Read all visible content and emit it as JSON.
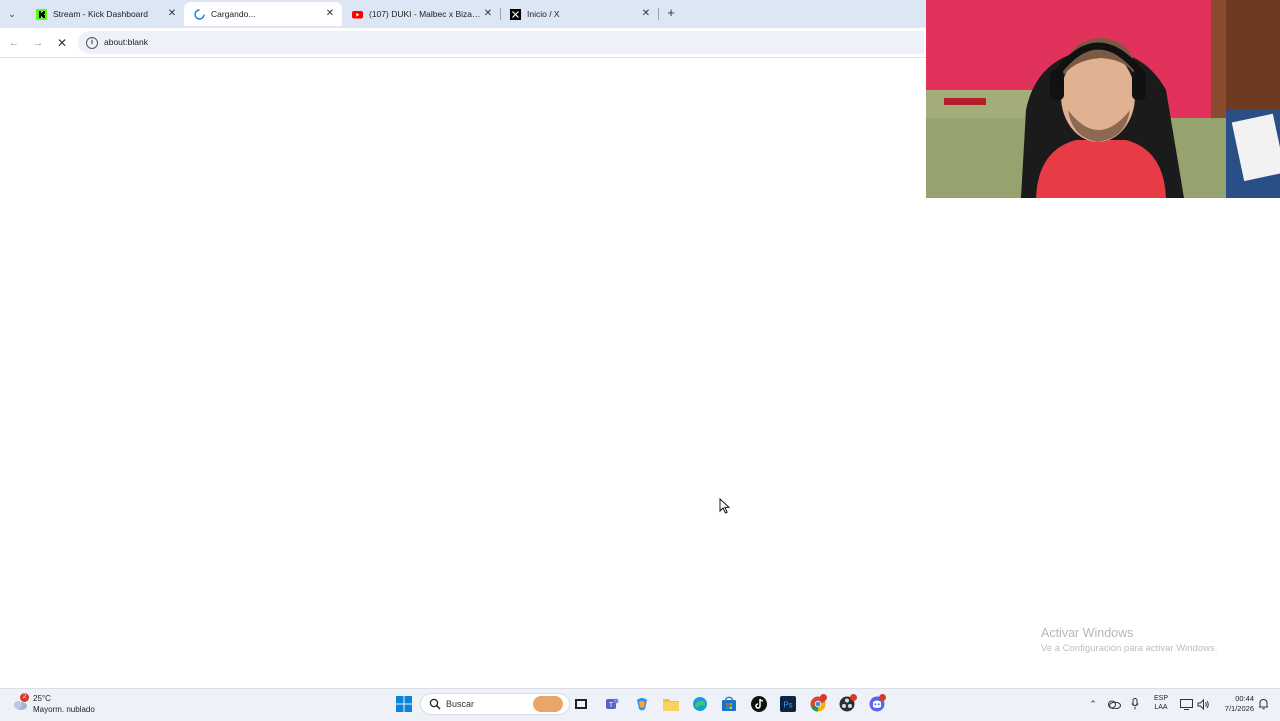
{
  "browser": {
    "tabs": [
      {
        "title": "Stream - Kick Dashboard",
        "favicon": "kick-icon",
        "active": false
      },
      {
        "title": "Cargando...",
        "favicon": "loading-spinner-icon",
        "active": true
      },
      {
        "title": "(107) DUKI - Malbec x Bizarrap",
        "favicon": "youtube-icon",
        "active": false
      },
      {
        "title": "Inicio / X",
        "favicon": "x-icon",
        "active": false
      }
    ],
    "new_tab_label": "+",
    "address": "about:blank"
  },
  "watermark": {
    "title": "Activar Windows",
    "subtitle": "Ve a Configuración para activar Windows."
  },
  "taskbar": {
    "weather": {
      "temp": "25°C",
      "condition": "Mayorm. nublado",
      "badge": "2"
    },
    "search_placeholder": "Buscar",
    "language": {
      "line1": "ESP",
      "line2": "LAA"
    },
    "clock": {
      "time": "00:44",
      "date": "7/1/2026"
    },
    "accent": "#0067c0"
  }
}
